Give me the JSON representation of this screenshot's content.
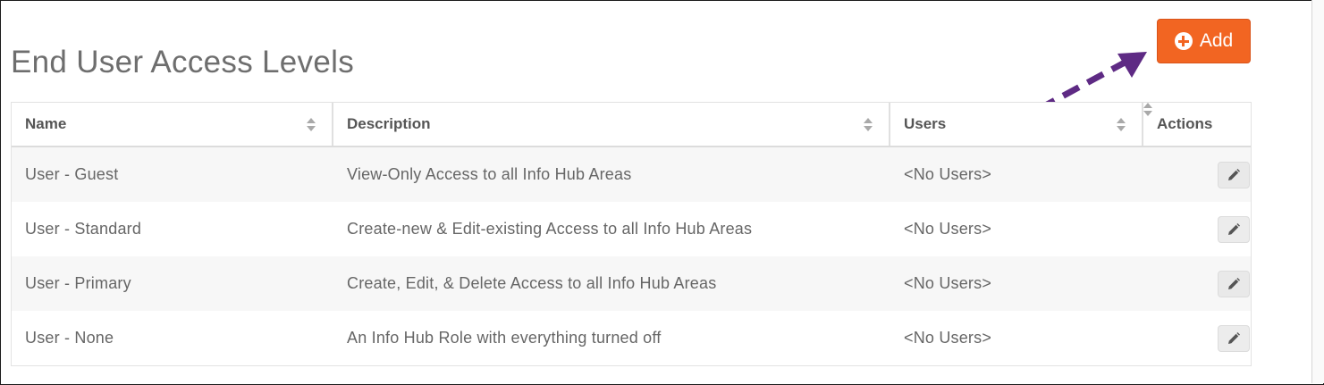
{
  "page": {
    "title": "End User Access Levels"
  },
  "toolbar": {
    "add_label": "Add",
    "add_icon": "plus-circle-icon",
    "accent": "#f26522"
  },
  "table": {
    "columns": [
      "Name",
      "Description",
      "Users",
      "Actions"
    ],
    "rows": [
      {
        "name": "User - Guest",
        "description": "View-Only Access to all Info Hub Areas",
        "users": "<No Users>"
      },
      {
        "name": "User - Standard",
        "description": "Create-new & Edit-existing Access to all Info Hub Areas",
        "users": "<No Users>"
      },
      {
        "name": "User - Primary",
        "description": "Create, Edit, & Delete Access to all Info Hub Areas",
        "users": "<No Users>"
      },
      {
        "name": "User - None",
        "description": "An Info Hub Role with everything turned off",
        "users": "<No Users>"
      }
    ],
    "action_icon": "pencil-icon"
  },
  "annotation": {
    "arrow_color": "#5e2a84"
  }
}
